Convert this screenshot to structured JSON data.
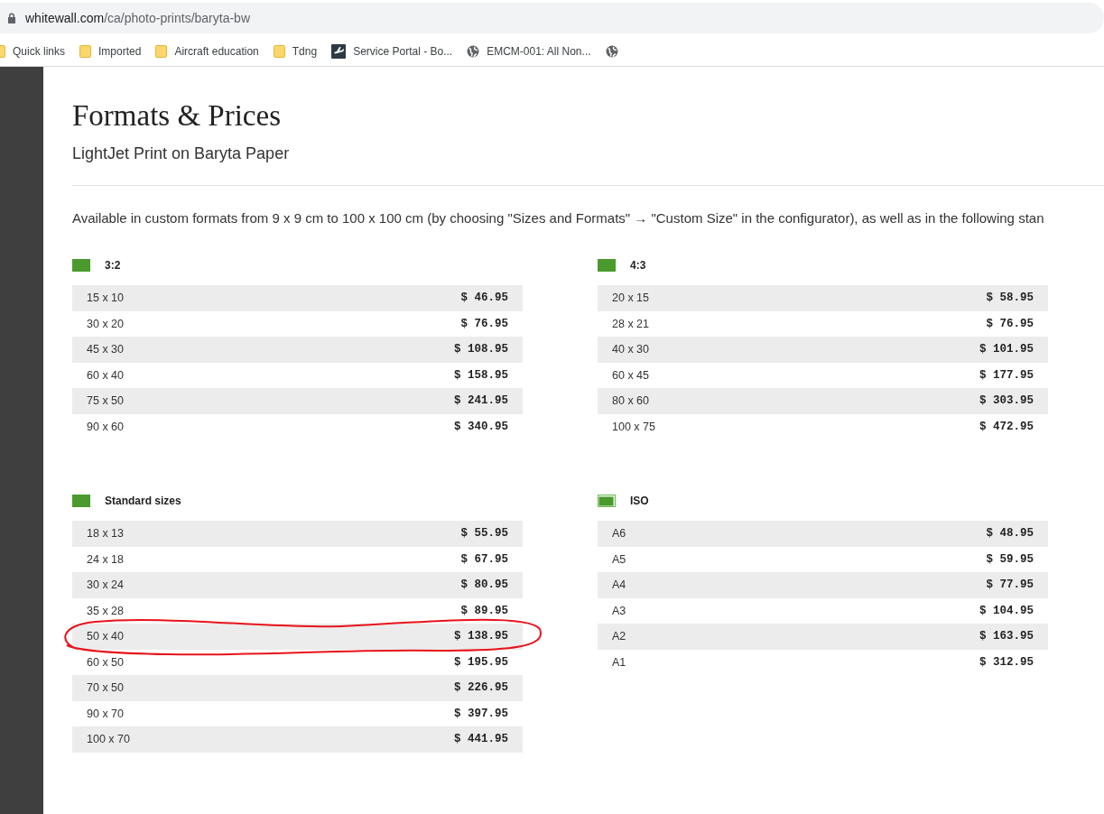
{
  "browser": {
    "url_host": "whitewall.com",
    "url_path": "/ca/photo-prints/baryta-bw",
    "bookmarks": [
      {
        "kind": "folder",
        "label": "Quick links"
      },
      {
        "kind": "folder",
        "label": "Imported"
      },
      {
        "kind": "folder",
        "label": "Aircraft education"
      },
      {
        "kind": "folder",
        "label": "Tdng"
      },
      {
        "kind": "plane",
        "label": "Service Portal - Bo..."
      },
      {
        "kind": "globe",
        "label": "EMCM-001: All Non..."
      },
      {
        "kind": "globe"
      }
    ]
  },
  "page": {
    "title": "Formats & Prices",
    "subtitle": "LightJet Print on Baryta Paper",
    "intro": "Available in custom formats from 9 x 9 cm to 100 x 100 cm (by choosing \"Sizes and Formats\" → \"Custom Size\" in the configurator), as well as in the following stan",
    "sections": [
      {
        "heading": "3:2",
        "kind": "solid",
        "rows": [
          {
            "size": "15 x 10",
            "price": "$ 46.95",
            "circled": false
          },
          {
            "size": "30 x 20",
            "price": "$ 76.95",
            "circled": false
          },
          {
            "size": "45 x 30",
            "price": "$ 108.95",
            "circled": false
          },
          {
            "size": "60 x 40",
            "price": "$ 158.95",
            "circled": false
          },
          {
            "size": "75 x 50",
            "price": "$ 241.95",
            "circled": false
          },
          {
            "size": "90 x 60",
            "price": "$ 340.95",
            "circled": false
          }
        ]
      },
      {
        "heading": "4:3",
        "kind": "solid",
        "rows": [
          {
            "size": "20 x 15",
            "price": "$ 58.95",
            "circled": false
          },
          {
            "size": "28 x 21",
            "price": "$ 76.95",
            "circled": false
          },
          {
            "size": "40 x 30",
            "price": "$ 101.95",
            "circled": false
          },
          {
            "size": "60 x 45",
            "price": "$ 177.95",
            "circled": false
          },
          {
            "size": "80 x 60",
            "price": "$ 303.95",
            "circled": false
          },
          {
            "size": "100 x 75",
            "price": "$ 472.95",
            "circled": false
          }
        ]
      },
      {
        "heading": "Standard sizes",
        "kind": "solid",
        "rows": [
          {
            "size": "18 x 13",
            "price": "$ 55.95",
            "circled": false
          },
          {
            "size": "24 x 18",
            "price": "$ 67.95",
            "circled": false
          },
          {
            "size": "30 x 24",
            "price": "$ 80.95",
            "circled": false
          },
          {
            "size": "35 x 28",
            "price": "$ 89.95",
            "circled": false
          },
          {
            "size": "50 x 40",
            "price": "$ 138.95",
            "circled": true
          },
          {
            "size": "60 x 50",
            "price": "$ 195.95",
            "circled": false
          },
          {
            "size": "70 x 50",
            "price": "$ 226.95",
            "circled": false
          },
          {
            "size": "90 x 70",
            "price": "$ 397.95",
            "circled": false
          },
          {
            "size": "100 x 70",
            "price": "$ 441.95",
            "circled": false
          }
        ]
      },
      {
        "heading": "ISO",
        "kind": "framed",
        "rows": [
          {
            "size": "A6",
            "price": "$ 48.95",
            "circled": false
          },
          {
            "size": "A5",
            "price": "$ 59.95",
            "circled": false
          },
          {
            "size": "A4",
            "price": "$ 77.95",
            "circled": false
          },
          {
            "size": "A3",
            "price": "$ 104.95",
            "circled": false
          },
          {
            "size": "A2",
            "price": "$ 163.95",
            "circled": false
          },
          {
            "size": "A1",
            "price": "$ 312.95",
            "circled": false
          }
        ]
      }
    ]
  }
}
